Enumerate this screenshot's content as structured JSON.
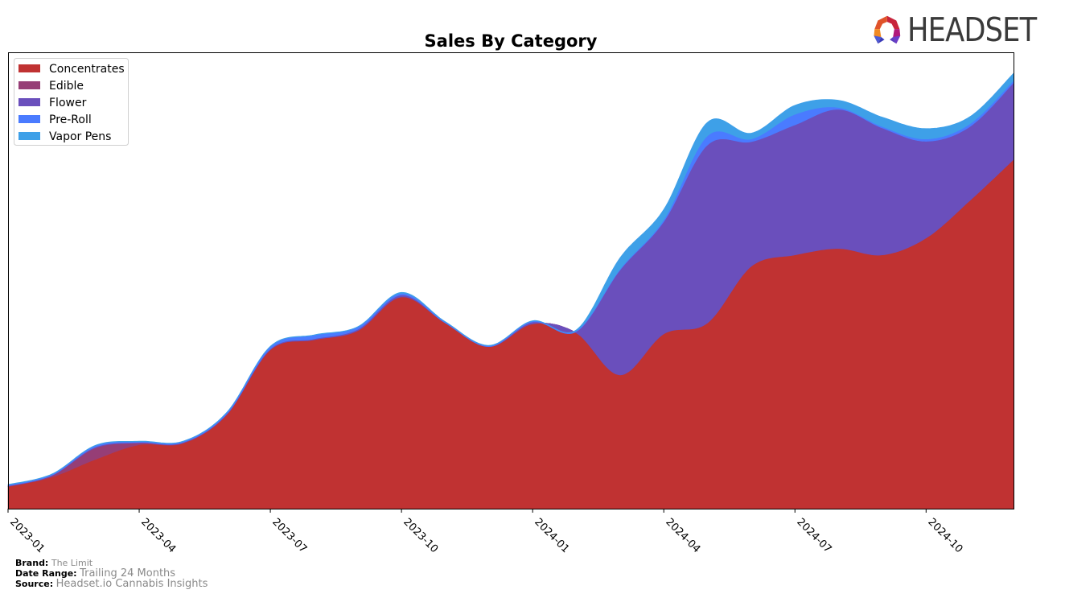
{
  "logo": {
    "text": "HEADSET"
  },
  "footer": {
    "brand_label": "Brand:",
    "brand_value": "The Limit",
    "date_range_label": "Date Range:",
    "date_range_value": "Trailing 24 Months",
    "source_label": "Source:",
    "source_value": "Headset.io Cannabis Insights"
  },
  "chart_data": {
    "type": "area",
    "stacked": true,
    "title": "Sales By Category",
    "xlabel": "",
    "ylabel": "",
    "ylim": [
      0,
      100
    ],
    "legend_position": "top-left",
    "grid": false,
    "x": [
      "2023-01",
      "2023-02",
      "2023-03",
      "2023-04",
      "2023-05",
      "2023-06",
      "2023-07",
      "2023-08",
      "2023-09",
      "2023-10",
      "2023-11",
      "2023-12",
      "2024-01",
      "2024-02",
      "2024-03",
      "2024-04",
      "2024-05",
      "2024-06",
      "2024-07",
      "2024-08",
      "2024-09",
      "2024-10",
      "2024-11",
      "2024-12"
    ],
    "x_ticks": [
      "2023-01",
      "2023-04",
      "2023-07",
      "2023-10",
      "2024-01",
      "2024-04",
      "2024-07",
      "2024-10"
    ],
    "series": [
      {
        "name": "Concentrates",
        "color": "#c03232",
        "values": [
          4.8,
          6.9,
          10.8,
          14.0,
          14.3,
          20.5,
          34.8,
          37.0,
          39.0,
          46.4,
          40.7,
          35.5,
          40.5,
          38.5,
          29.3,
          38.3,
          40.7,
          53.1,
          55.6,
          57.0,
          55.6,
          59.3,
          67.5,
          76.5
        ]
      },
      {
        "name": "Edible",
        "color": "#963e76",
        "values": [
          0.1,
          0.3,
          2.5,
          0.4,
          0.1,
          0.1,
          0.0,
          0.0,
          0.0,
          0.0,
          0.0,
          0.0,
          0.0,
          0.0,
          0.0,
          0.0,
          0.0,
          0.0,
          0.0,
          0.0,
          0.0,
          0.0,
          0.0,
          0.0
        ]
      },
      {
        "name": "Flower",
        "color": "#6a4fbc",
        "values": [
          0.1,
          0.1,
          0.2,
          0.1,
          0.1,
          0.1,
          0.2,
          0.2,
          0.3,
          0.4,
          0.0,
          0.0,
          0.4,
          0.3,
          23.0,
          24.6,
          39.0,
          27.3,
          28.5,
          30.5,
          27.8,
          21.2,
          16.2,
          16.8
        ]
      },
      {
        "name": "Pre-Roll",
        "color": "#4a7bff",
        "values": [
          0.2,
          0.2,
          0.3,
          0.2,
          0.2,
          0.3,
          0.5,
          0.8,
          0.5,
          0.4,
          0.2,
          0.2,
          0.2,
          0.2,
          0.2,
          0.4,
          2.0,
          0.6,
          2.3,
          0.4,
          0.3,
          0.5,
          0.6,
          0.5
        ]
      },
      {
        "name": "Vapor Pens",
        "color": "#3ea0e8",
        "values": [
          0.1,
          0.1,
          0.1,
          0.1,
          0.1,
          0.1,
          0.1,
          0.1,
          0.1,
          0.2,
          0.1,
          0.1,
          0.1,
          0.2,
          2.5,
          2.3,
          3.0,
          1.3,
          2.0,
          1.6,
          2.1,
          2.3,
          1.6,
          1.6
        ]
      }
    ]
  }
}
